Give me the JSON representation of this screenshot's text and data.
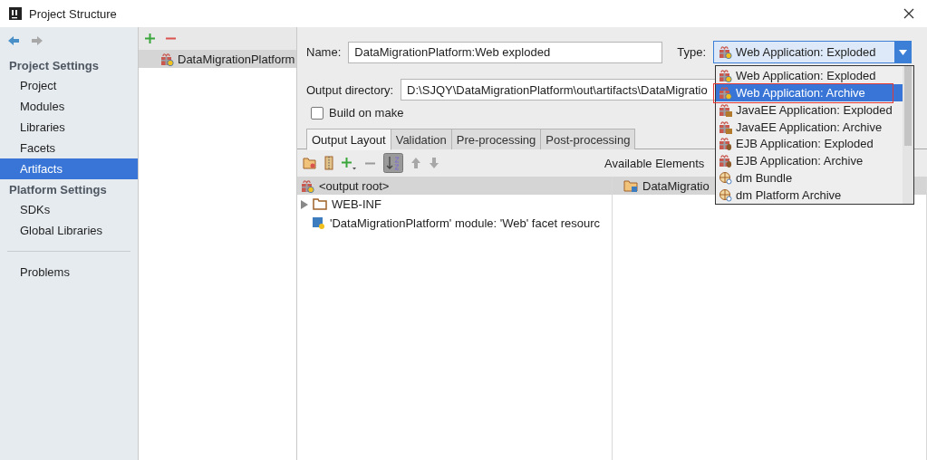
{
  "window": {
    "title": "Project Structure"
  },
  "sidebar": {
    "sections": [
      {
        "title": "Project Settings",
        "items": [
          {
            "label": "Project",
            "selected": false
          },
          {
            "label": "Modules",
            "selected": false
          },
          {
            "label": "Libraries",
            "selected": false
          },
          {
            "label": "Facets",
            "selected": false
          },
          {
            "label": "Artifacts",
            "selected": true
          }
        ]
      },
      {
        "title": "Platform Settings",
        "items": [
          {
            "label": "SDKs",
            "selected": false
          },
          {
            "label": "Global Libraries",
            "selected": false
          }
        ]
      }
    ],
    "footer_items": [
      {
        "label": "Problems",
        "selected": false
      }
    ]
  },
  "artifacts_list": {
    "items": [
      {
        "label": "DataMigrationPlatform",
        "selected": true
      }
    ]
  },
  "form": {
    "name_label": "Name:",
    "name_value": "DataMigrationPlatform:Web exploded",
    "type_label": "Type:",
    "type_value": "Web Application: Exploded",
    "output_label": "Output directory:",
    "output_value": "D:\\SJQY\\DataMigrationPlatform\\out\\artifacts\\DataMigratio",
    "build_on_make": {
      "label": "Build on make",
      "checked": false
    }
  },
  "tabs": [
    {
      "label": "Output Layout",
      "selected": true
    },
    {
      "label": "Validation",
      "selected": false
    },
    {
      "label": "Pre-processing",
      "selected": false
    },
    {
      "label": "Post-processing",
      "selected": false
    }
  ],
  "layout": {
    "root": "<output root>",
    "items": [
      {
        "label": "WEB-INF",
        "kind": "folder"
      },
      {
        "label": "'DataMigrationPlatform' module: 'Web' facet resourc",
        "kind": "module"
      }
    ]
  },
  "available": {
    "title": "Available Elements",
    "root": "DataMigratio"
  },
  "type_dropdown": {
    "items": [
      {
        "label": "Web Application: Exploded",
        "kind": "web",
        "selected": false
      },
      {
        "label": "Web Application: Archive",
        "kind": "web",
        "selected": true
      },
      {
        "label": "JavaEE Application: Exploded",
        "kind": "javaee",
        "selected": false
      },
      {
        "label": "JavaEE Application: Archive",
        "kind": "javaee",
        "selected": false
      },
      {
        "label": "EJB Application: Exploded",
        "kind": "ejb",
        "selected": false
      },
      {
        "label": "EJB Application: Archive",
        "kind": "ejb",
        "selected": false
      },
      {
        "label": "dm Bundle",
        "kind": "dm",
        "selected": false
      },
      {
        "label": "dm Platform Archive",
        "kind": "dm",
        "selected": false
      }
    ]
  }
}
